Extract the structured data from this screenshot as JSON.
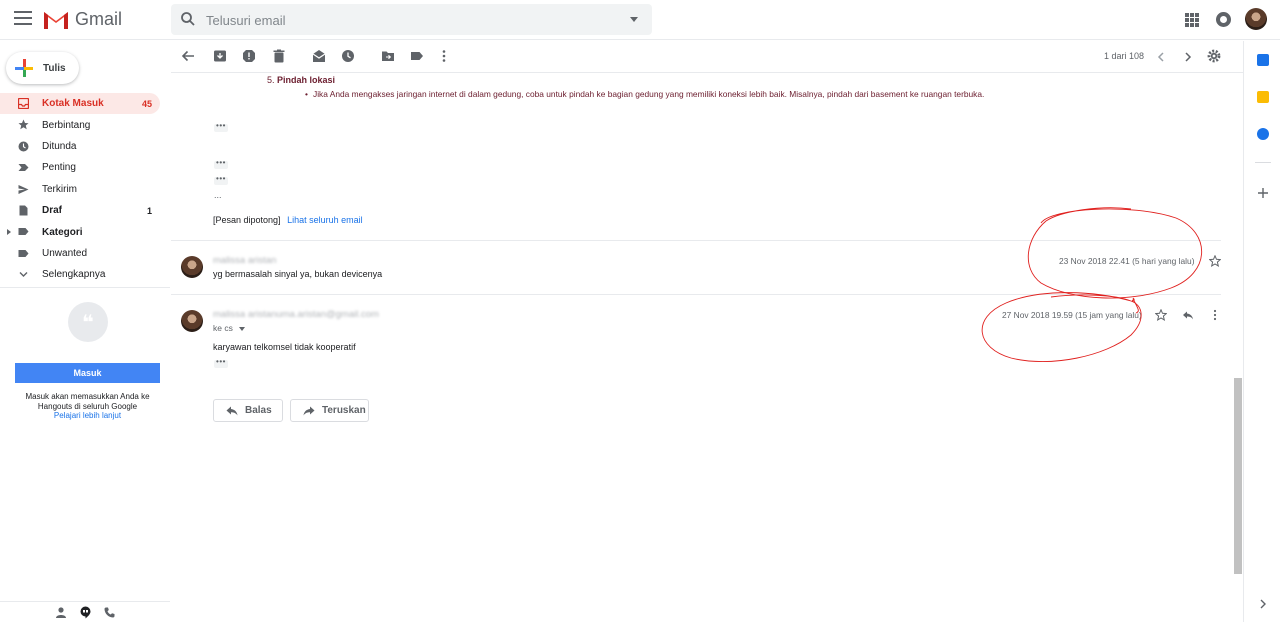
{
  "app": {
    "name": "Gmail",
    "search_placeholder": "Telusuri email"
  },
  "sidebar": {
    "compose_label": "Tulis",
    "items": [
      {
        "label": "Kotak Masuk",
        "count": "45"
      },
      {
        "label": "Berbintang",
        "count": ""
      },
      {
        "label": "Ditunda",
        "count": ""
      },
      {
        "label": "Penting",
        "count": ""
      },
      {
        "label": "Terkirim",
        "count": ""
      },
      {
        "label": "Draf",
        "count": "1"
      },
      {
        "label": "Kategori",
        "count": ""
      },
      {
        "label": "Unwanted",
        "count": ""
      },
      {
        "label": "Selengkapnya",
        "count": ""
      }
    ],
    "hangouts": {
      "button_label": "Masuk",
      "text": "Masuk akan memasukkan Anda ke Hangouts di seluruh Google",
      "link": "Pelajari lebih lanjut"
    }
  },
  "toolbar": {
    "pager": "1 dari 108"
  },
  "thread": {
    "list_item_number": "5.",
    "list_item_title": "Pindah lokasi",
    "list_item_body": "Jika Anda mengakses jaringan internet di dalam gedung, coba untuk pindah ke bagian gedung yang memiliki koneksi lebih baik. Misalnya, pindah dari basement ke ruangan terbuka.",
    "ellipsis": "...",
    "clipped_label": "[Pesan dipotong]",
    "clipped_link": "Lihat seluruh email",
    "messages": [
      {
        "sender": "malissa aristan",
        "snippet": "yg bermasalah sinyal ya, bukan devicenya",
        "date": "23 Nov 2018 22.41 (5 hari yang lalu)"
      },
      {
        "sender": "malissa aristanuma.aristan@gmail.com",
        "to": "ke cs",
        "body": "karyawan telkomsel tidak kooperatif",
        "date": "27 Nov 2018 19.59 (15 jam yang lalu)"
      }
    ],
    "reply_label": "Balas",
    "forward_label": "Teruskan"
  },
  "colors": {
    "accent_red": "#d93025",
    "brand_blue": "#4285f4",
    "annotation_red": "#e0201e"
  }
}
